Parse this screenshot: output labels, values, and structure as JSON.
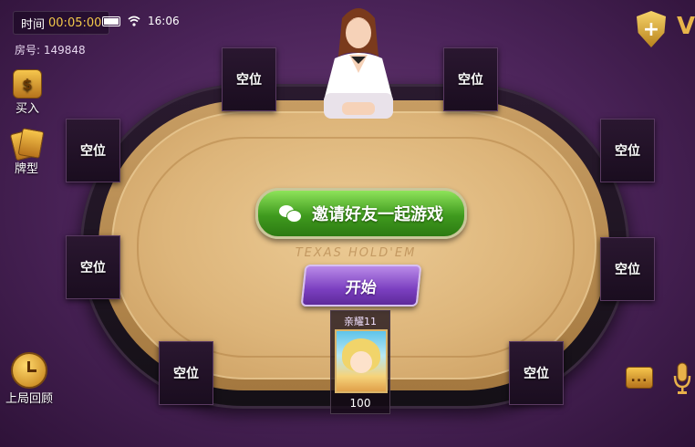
{
  "status": {
    "time_label": "时间",
    "time_value": "00:05:00",
    "clock": "16:06"
  },
  "room": {
    "label": "房号: 149848"
  },
  "side": {
    "buy_in": "买入",
    "hand_types": "牌型",
    "replay": "上局回顾"
  },
  "table": {
    "brand": "TEXAS HOLD'EM"
  },
  "seats": {
    "top_left": "空位",
    "top_right": "空位",
    "left_upper": "空位",
    "left_lower": "空位",
    "right_upper": "空位",
    "right_lower": "空位",
    "bottom_left": "空位",
    "bottom_right": "空位"
  },
  "buttons": {
    "invite": "邀请好友一起游戏",
    "start": "开始"
  },
  "player": {
    "name": "亲耀11",
    "chips": "100"
  },
  "icons": {
    "dollar": "$",
    "plus": "+",
    "vip": "V",
    "chat": "..."
  },
  "colors": {
    "accent_gold": "#f3c94a",
    "invite_green": "#3f9a1e",
    "start_purple": "#7b3fc0",
    "background": "#4a2358"
  }
}
